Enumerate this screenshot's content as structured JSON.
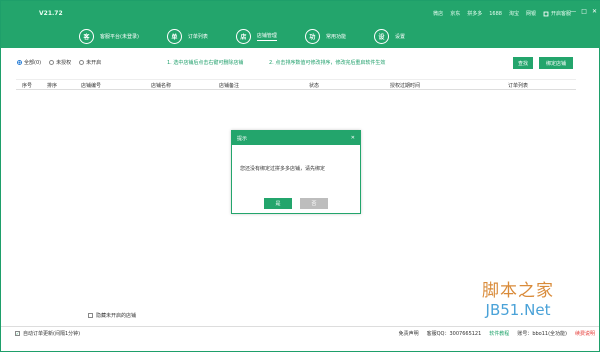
{
  "app": {
    "version": "V21.72"
  },
  "platforms": [
    "微店",
    "京东",
    "拼多多",
    "1688",
    "淘宝",
    "网银"
  ],
  "open_help": "开启客服",
  "window_controls": [
    "—",
    "□",
    "✕"
  ],
  "nav": [
    {
      "icon": "客",
      "label": "客服平台(未登录)",
      "active": false
    },
    {
      "icon": "单",
      "label": "订单列表",
      "active": false
    },
    {
      "icon": "店",
      "label": "店铺管理",
      "active": true
    },
    {
      "icon": "功",
      "label": "常用功能",
      "active": false
    },
    {
      "icon": "设",
      "label": "设置",
      "active": false
    }
  ],
  "filter": {
    "options": [
      {
        "label": "全部(0)",
        "checked": true
      },
      {
        "label": "未授权",
        "checked": false
      },
      {
        "label": "未开启",
        "checked": false
      }
    ]
  },
  "tips": {
    "tip1": "1. 选中店铺后点击右键可删除店铺",
    "tip2": "2. 点击排序数值可修改排序，修改完后重启软件生效"
  },
  "buttons": {
    "search": "查找",
    "bind_store": "绑定店铺"
  },
  "table": {
    "headers": [
      "序号",
      "排序",
      "店铺编号",
      "店铺名称",
      "店铺备注",
      "状态",
      "授权过期时间",
      "订单列表"
    ]
  },
  "dialog": {
    "title": "提示",
    "close": "✕",
    "message": "您还没有绑定过拼多多店铺，请先绑定",
    "ok": "是",
    "cancel": "否"
  },
  "hide_closed": {
    "label": "隐藏未开启的店铺",
    "checked": false
  },
  "footer": {
    "auto_update_label": "自动订单更新(间隔1分钟)",
    "auto_update_checked": true,
    "disclaimer": "免责声明",
    "service_qq": "客服QQ：3007665121",
    "tutorial": "软件教程",
    "account": "账号：bbo11(全功能)",
    "renew": "续费说明"
  },
  "watermark": {
    "cn": "脚本之家",
    "en": "JB51.Net"
  },
  "colors": {
    "brand_green": "#23a56c",
    "red": "#e53935"
  }
}
